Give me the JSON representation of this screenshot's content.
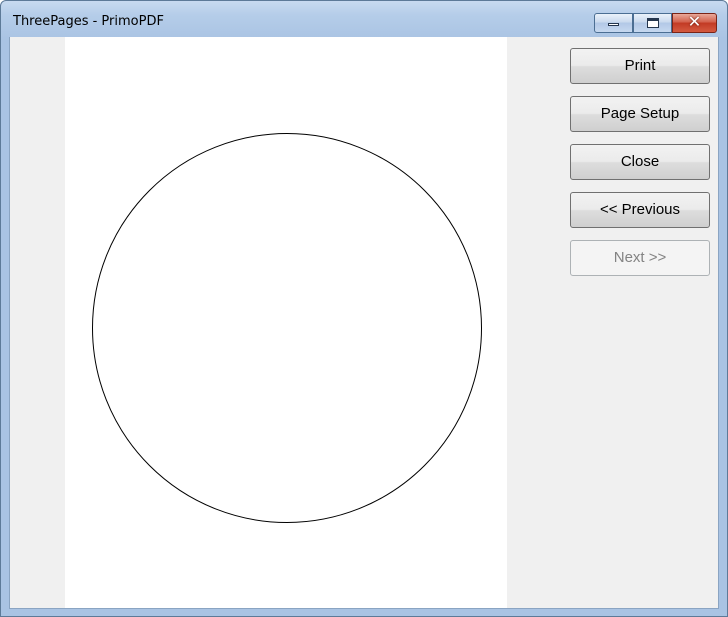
{
  "window": {
    "title": "ThreePages - PrimoPDF"
  },
  "caption_buttons": {
    "minimize_icon": "minimize-icon",
    "maximize_icon": "restore-icon",
    "close_icon": "close-icon",
    "close_glyph": "✕"
  },
  "preview": {
    "page_content": "circle"
  },
  "buttons": {
    "print": "Print",
    "page_setup": "Page Setup",
    "close": "Close",
    "previous": "<< Previous",
    "next": "Next >>"
  },
  "colors": {
    "titlebar": "#a9c3e3",
    "client_bg": "#f0f0f0",
    "page_bg": "#ffffff",
    "close_button": "#c23a24"
  }
}
